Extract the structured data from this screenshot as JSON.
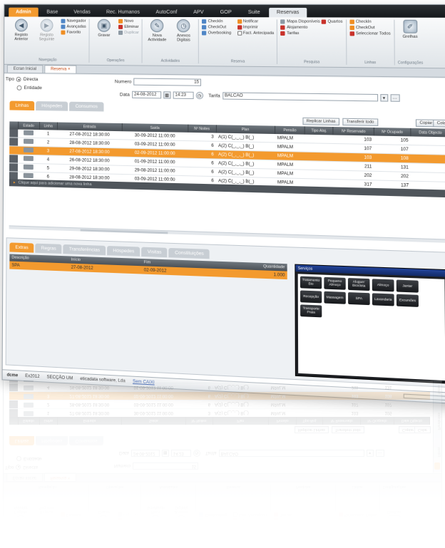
{
  "menu": {
    "tabs": [
      "Admin",
      "Base",
      "Vendas",
      "Rec. Humanos",
      "AutoConf",
      "APV",
      "GOP",
      "Suite",
      "Reservas"
    ],
    "active": "Reservas"
  },
  "ribbon": {
    "nav": {
      "back": "Registo Anterior",
      "next": "Registo Seguinte",
      "navegador": "Navegador",
      "avancadas": "Avançadas",
      "favorito": "Favorito",
      "title": "Navegação"
    },
    "edit": {
      "gravar": "Gravar",
      "novo": "Novo",
      "eliminar": "Eliminar",
      "duplicar": "Duplicar",
      "title": "Operações"
    },
    "activity": {
      "nova": "Nova Actividade",
      "anexos": "Anexos Digitais",
      "title": "Actividades"
    },
    "reserva": {
      "checkin": "CheckIn",
      "checkout": "CheckOut",
      "overbooking": "Overbooking",
      "fact": "Fact. Antecipada",
      "notificar": "Notificar",
      "imprimir": "Imprimir",
      "title": "Reserva"
    },
    "quartos": {
      "mapa": "Mapa Disponíveis",
      "quartos": "Quartos",
      "alojamento": "Alojamento",
      "tarifas": "Tarifas",
      "title": "Pesquisa"
    },
    "linhas": {
      "checkin": "CheckIn",
      "checkout": "CheckOut",
      "selecionar": "Seleccionar Todos",
      "title": "Linhas"
    },
    "config": {
      "grelhas": "Grelhas",
      "title": "Configurações"
    }
  },
  "doctabs": [
    "Ecran Inicial",
    "Reserva"
  ],
  "form": {
    "tipo_label": "Tipo",
    "tipo_directa": "Directa",
    "tipo_entidade": "Entidade",
    "numero_label": "Numero",
    "numero_value": "15",
    "data_label": "Data",
    "data_value": "24-08-2012",
    "hora_value": "14:23",
    "tarifa_label": "Tarifa",
    "tarifa_value": "BALCAO"
  },
  "subtabs": [
    "Linhas",
    "Hóspedes",
    "Consumos"
  ],
  "grid_buttons": {
    "replicar": "Replicar Linhas",
    "transferir": "Transferir todo",
    "copiar": "Copiar",
    "colar": "Colar"
  },
  "lines": {
    "headers": [
      "Estado",
      "Linha",
      "Entrada",
      "Saida",
      "Nº Noites",
      "Plan",
      "Pensão",
      "Tipo Aloj.",
      "Nº Reservado",
      "Nº Ocupado",
      "Data Objecto"
    ],
    "rows": [
      {
        "linha": "1",
        "entrada": "27-08-2012 18:30:00",
        "saida": "30-09-2012 11:00:00",
        "noites": "3",
        "plan": "A(1) C(_,_,_) B(_)",
        "pensao": "MPALM",
        "reservado": "103",
        "ocupado": "105"
      },
      {
        "linha": "2",
        "entrada": "28-08-2012 18:30:00",
        "saida": "03-09-2012 11:00:00",
        "noites": "6",
        "plan": "A(2) C(_,_,_) B(_)",
        "pensao": "MPALM",
        "reservado": "107",
        "ocupado": "107"
      },
      {
        "linha": "3",
        "entrada": "27-08-2012 18:30:00",
        "saida": "02-09-2012 11:00:00",
        "noites": "6",
        "plan": "A(2) C(_,_,_) B(_)",
        "pensao": "MPALM",
        "reservado": "103",
        "ocupado": "108"
      },
      {
        "linha": "4",
        "entrada": "26-08-2012 18:30:00",
        "saida": "01-09-2012 11:00:00",
        "noites": "6",
        "plan": "A(2) C(_,_,_) B(_)",
        "pensao": "MPALM",
        "reservado": "211",
        "ocupado": "131"
      },
      {
        "linha": "5",
        "entrada": "29-08-2012 18:30:00",
        "saida": "29-08-2012 11:00:00",
        "noites": "6",
        "plan": "A(2) C(_,_,_) B(_)",
        "pensao": "MPALM",
        "reservado": "202",
        "ocupado": "202"
      },
      {
        "linha": "6",
        "entrada": "28-08-2012 18:30:00",
        "saida": "03-09-2012 11:00:00",
        "noites": "6",
        "plan": "A(2) C(_,_,_) B(_)",
        "pensao": "MPALM",
        "reservado": "317",
        "ocupado": "137"
      }
    ],
    "selected_index": 2,
    "add_row_text": "Clique aqui para adicionar uma nova linha"
  },
  "bottom_tabs": [
    "Extras",
    "Regras",
    "Transferências",
    "Hóspedes",
    "Visitas",
    "Constituições"
  ],
  "extras": {
    "headers": [
      "Descrição",
      "Início",
      "Fim",
      "Quantidade"
    ],
    "rows": [
      {
        "descricao": "SPA",
        "inicio": "27-08-2012",
        "fim": "02-09-2012",
        "quantidade": "1.000"
      }
    ]
  },
  "touch": {
    "title": "Serviços",
    "buttons": [
      "Tratamento Bio",
      "Pequeno Almoço",
      "Aluguer Bicicleta",
      "Almoço",
      "Jantar",
      "Recepção",
      "Massagem",
      "SPA",
      "Lavandaria",
      "Excursões",
      "Transporte Praia"
    ]
  },
  "status": {
    "brand": "dcme",
    "company": "Ex2012",
    "section": "SECÇÃO UM",
    "vendor": "eticadata software, Lda",
    "link": "Sem CAIXI"
  },
  "side_tabs": [
    "Filtros",
    "Pendentes",
    "Notas"
  ],
  "colors": {
    "accent": "#f39a2e",
    "dark": "#15181b",
    "selected_row": "#f39a2e"
  }
}
